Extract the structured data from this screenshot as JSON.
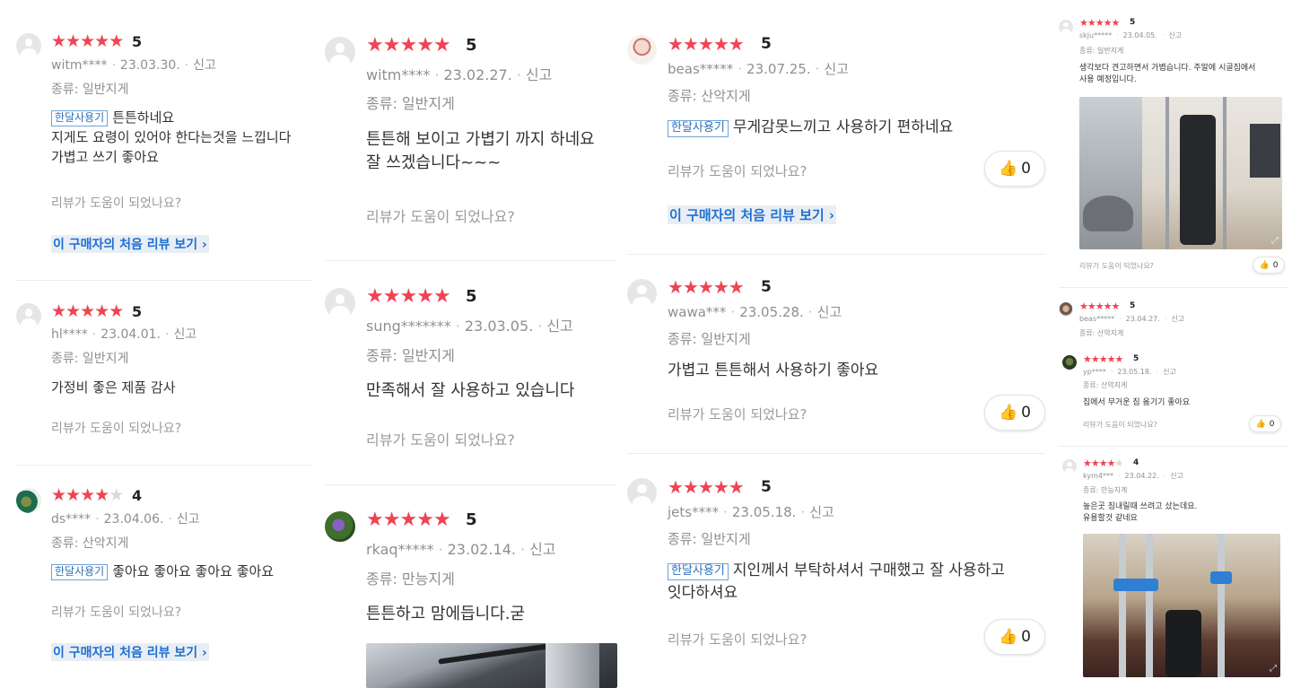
{
  "common": {
    "report": "신고",
    "helpful_q": "리뷰가 도움이 되었나요?",
    "first_review_link": "이 구매자의 처음 리뷰 보기",
    "tag_month": "한달사용기",
    "star_glyph": "★",
    "thumb_icon": "thumbs-up-icon",
    "accent_color": "#ef4454",
    "link_color": "#1f6fd1"
  },
  "col1": [
    {
      "user": "witm****",
      "date": "23.03.30.",
      "rating": 5,
      "type": "종류: 일반지게",
      "tag": true,
      "text": "튼튼하네요\n지게도 요령이 있어야 한다는것을  느낍니다\n가볍고 쓰기 좋아요"
    },
    {
      "user": "hl****",
      "date": "23.04.01.",
      "rating": 5,
      "type": "종류: 일반지게",
      "tag": false,
      "text": "가정비 좋은 제품 감사"
    },
    {
      "user": "ds****",
      "date": "23.04.06.",
      "rating": 4,
      "type": "종류: 산악지게",
      "tag": true,
      "text": "좋아요 좋아요 좋아요 좋아요"
    }
  ],
  "col2": [
    {
      "user": "witm****",
      "date": "23.02.27.",
      "rating": 5,
      "type": "종류: 일반지게",
      "text": "튼튼해 보이고 가볍기 까지 하네요\n잘 쓰겠습니다~~~"
    },
    {
      "user": "sung*******",
      "date": "23.03.05.",
      "rating": 5,
      "type": "종류: 일반지게",
      "text": "만족해서 잘 사용하고 있습니다"
    },
    {
      "user": "rkaq*****",
      "date": "23.02.14.",
      "rating": 5,
      "type": "종류: 만능지게",
      "text": "튼튼하고 맘에듭니다.굳"
    }
  ],
  "col3": [
    {
      "user": "beas*****",
      "date": "23.07.25.",
      "rating": 5,
      "type": "종류: 산악지게",
      "tag": true,
      "text": "무게감못느끼고 사용하기 편하네요",
      "likes": "0"
    },
    {
      "user": "wawa***",
      "date": "23.05.28.",
      "rating": 5,
      "type": "종류: 일반지게",
      "tag": false,
      "text": "가볍고 튼튼해서 사용하기 좋아요",
      "likes": "0"
    },
    {
      "user": "jets****",
      "date": "23.05.18.",
      "rating": 5,
      "type": "종류: 일반지게",
      "tag": true,
      "text": "지인께서 부탁하셔서 구매했고 잘 사용하고\n잇다하셔요",
      "likes": "0"
    }
  ],
  "col4": [
    {
      "user": "skju*****",
      "date": "23.04.05.",
      "rating": 5,
      "type": "종류: 일반지게",
      "text": "생각보다 견고하면서 가볍습니다.  주말에 시골집에서\n사용 예정입니다.",
      "likes": "0"
    },
    {
      "user": "beas*****",
      "date": "23.04.27.",
      "rating": 5,
      "type": "종류: 산악지게"
    },
    {
      "user": "yp****",
      "date": "23.05.18.",
      "rating": 5,
      "type": "종류: 산악지게",
      "text": "집에서 무거운 짐 옮기기 좋아요",
      "likes": "0"
    },
    {
      "user": "kym4***",
      "date": "23.04.22.",
      "rating": 4,
      "type": "종류: 만능지게",
      "text": "높은곳 짐내릴때 쓰려고 샀는데요.\n유용할것 같네요"
    }
  ]
}
